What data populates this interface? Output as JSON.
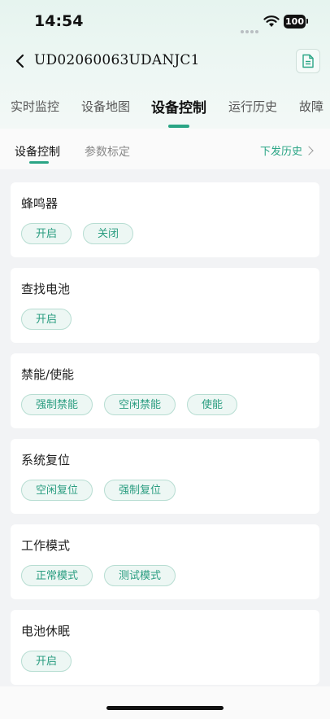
{
  "status_bar": {
    "time": "14:54",
    "battery": "100"
  },
  "nav": {
    "title": "UD02060063UDANJC1"
  },
  "tabs": [
    {
      "label": "实时监控"
    },
    {
      "label": "设备地图"
    },
    {
      "label": "设备控制"
    },
    {
      "label": "运行历史"
    },
    {
      "label": "故障"
    }
  ],
  "subtabs": [
    {
      "label": "设备控制"
    },
    {
      "label": "参数标定"
    }
  ],
  "history_link": "下发历史",
  "cards": [
    {
      "title": "蜂鸣器",
      "buttons": [
        "开启",
        "关闭"
      ]
    },
    {
      "title": "查找电池",
      "buttons": [
        "开启"
      ]
    },
    {
      "title": "禁能/使能",
      "buttons": [
        "强制禁能",
        "空闲禁能",
        "使能"
      ]
    },
    {
      "title": "系统复位",
      "buttons": [
        "空闲复位",
        "强制复位"
      ]
    },
    {
      "title": "工作模式",
      "buttons": [
        "正常模式",
        "测试模式"
      ]
    },
    {
      "title": "电池休眠",
      "buttons": [
        "开启"
      ]
    }
  ],
  "colors": {
    "accent": "#2aa585",
    "pill_bg": "#edf7f4",
    "pill_border": "#b7ddd2"
  }
}
